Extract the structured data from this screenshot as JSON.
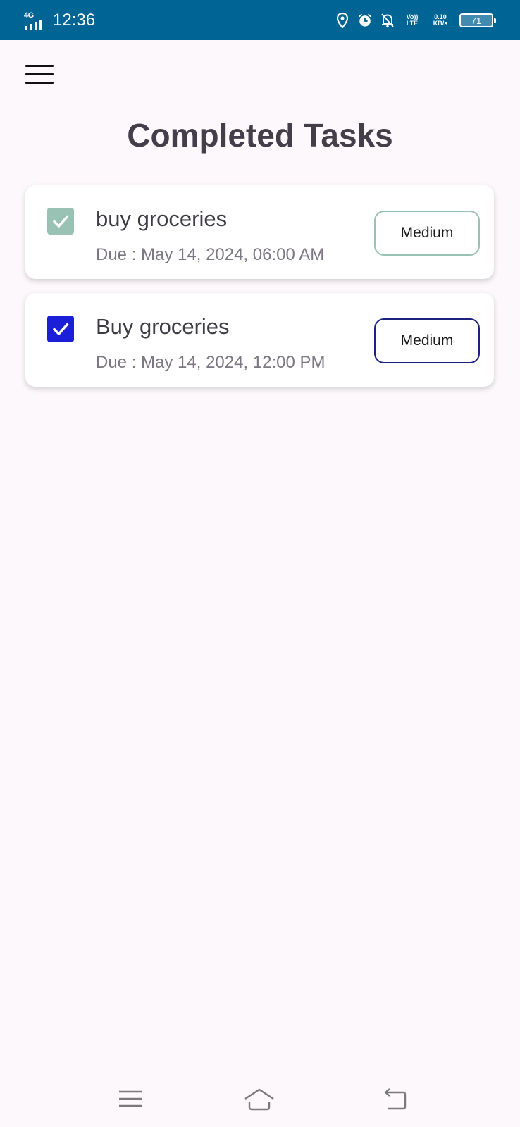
{
  "status_bar": {
    "network": "4G",
    "time": "12:36",
    "volte_label": "Vo)) LTE",
    "speed_value": "0.10",
    "speed_unit": "KB/s",
    "battery": "71",
    "icons": [
      "signal-icon",
      "location-icon",
      "alarm-icon",
      "bell-off-icon",
      "volte-icon",
      "battery-icon"
    ]
  },
  "header": {
    "menu_icon": "hamburger-menu-icon",
    "title": "Completed Tasks"
  },
  "tasks": [
    {
      "title": "buy groceries",
      "due": "Due : May 14, 2024, 06:00 AM",
      "priority": "Medium",
      "checked": true,
      "accent_color": "#99c2b4"
    },
    {
      "title": "Buy groceries",
      "due": "Due : May 14, 2024, 12:00 PM",
      "priority": "Medium",
      "checked": true,
      "accent_color": "#1b1fd8"
    }
  ],
  "nav_bar": {
    "icons": [
      "recent-apps-icon",
      "home-icon",
      "back-icon"
    ]
  },
  "colors": {
    "status_bar": "#006494",
    "background": "#fdf8fc",
    "title_text": "#433f4a"
  }
}
